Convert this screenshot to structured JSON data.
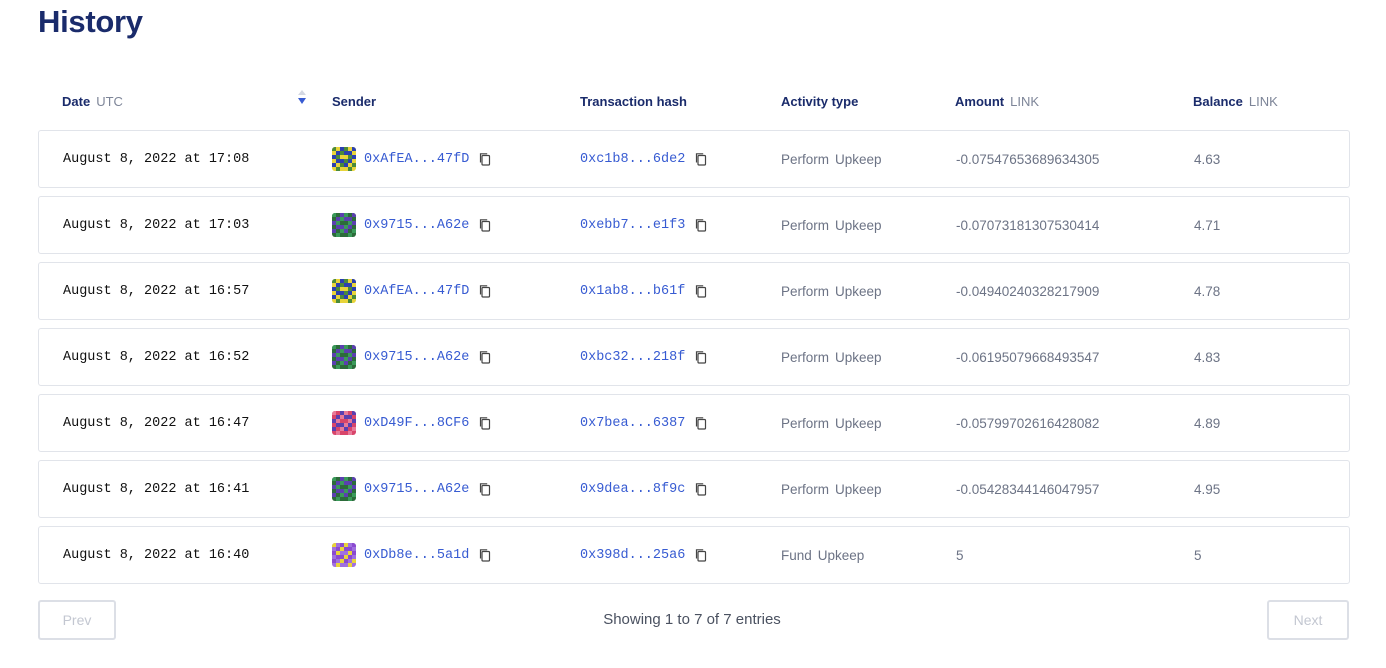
{
  "page": {
    "title": "History"
  },
  "columns": {
    "date": {
      "label": "Date",
      "unit": "UTC"
    },
    "sender": {
      "label": "Sender"
    },
    "hash": {
      "label": "Transaction hash"
    },
    "type": {
      "label": "Activity type"
    },
    "amount": {
      "label": "Amount",
      "unit": "LINK"
    },
    "balance": {
      "label": "Balance",
      "unit": "LINK"
    }
  },
  "sort": {
    "column": "date",
    "direction": "descending"
  },
  "rows": [
    {
      "date": "August 8, 2022 at 17:08",
      "sender": "0xAfEA...47fD",
      "avatar": "yellow-blue",
      "hash": "0xc1b8...6de2",
      "type_a": "Perform",
      "type_b": "Upkeep",
      "amount": "-0.07547653689634305",
      "balance": "4.63"
    },
    {
      "date": "August 8, 2022 at 17:03",
      "sender": "0x9715...A62e",
      "avatar": "green-purple",
      "hash": "0xebb7...e1f3",
      "type_a": "Perform",
      "type_b": "Upkeep",
      "amount": "-0.07073181307530414",
      "balance": "4.71"
    },
    {
      "date": "August 8, 2022 at 16:57",
      "sender": "0xAfEA...47fD",
      "avatar": "yellow-blue",
      "hash": "0x1ab8...b61f",
      "type_a": "Perform",
      "type_b": "Upkeep",
      "amount": "-0.04940240328217909",
      "balance": "4.78"
    },
    {
      "date": "August 8, 2022 at 16:52",
      "sender": "0x9715...A62e",
      "avatar": "green-purple",
      "hash": "0xbc32...218f",
      "type_a": "Perform",
      "type_b": "Upkeep",
      "amount": "-0.06195079668493547",
      "balance": "4.83"
    },
    {
      "date": "August 8, 2022 at 16:47",
      "sender": "0xD49F...8CF6",
      "avatar": "red-purple",
      "hash": "0x7bea...6387",
      "type_a": "Perform",
      "type_b": "Upkeep",
      "amount": "-0.05799702616428082",
      "balance": "4.89"
    },
    {
      "date": "August 8, 2022 at 16:41",
      "sender": "0x9715...A62e",
      "avatar": "green-purple",
      "hash": "0x9dea...8f9c",
      "type_a": "Perform",
      "type_b": "Upkeep",
      "amount": "-0.05428344146047957",
      "balance": "4.95"
    },
    {
      "date": "August 8, 2022 at 16:40",
      "sender": "0xDb8e...5a1d",
      "avatar": "violet-yellow",
      "hash": "0x398d...25a6",
      "type_a": "Fund",
      "type_b": "Upkeep",
      "amount": "5",
      "balance": "5"
    }
  ],
  "pagination": {
    "prev_label": "Prev",
    "next_label": "Next",
    "summary": "Showing 1 to 7 of 7 entries"
  },
  "colors": {
    "title": "#1a2b6b",
    "link": "#375bd2",
    "muted": "#6c7385",
    "border": "#e1e4ea"
  },
  "icons": {
    "copy": "copy-icon",
    "sort": "sort-descending-icon",
    "avatar": "identicon-avatar"
  }
}
